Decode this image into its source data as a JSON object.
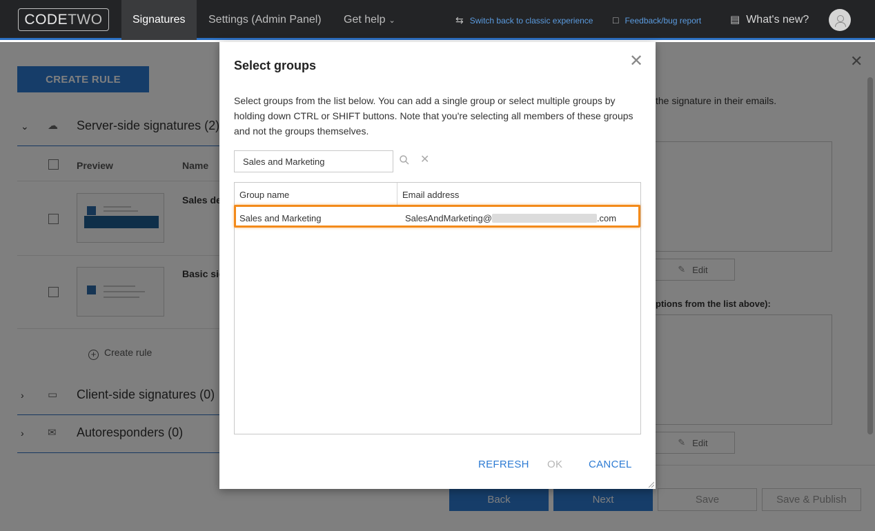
{
  "topbar": {
    "logo_code": "CODE",
    "logo_two": "TWO",
    "tabs": [
      {
        "label": "Signatures"
      },
      {
        "label": "Settings (Admin Panel)"
      },
      {
        "label": "Get help"
      }
    ],
    "switch_link": "Switch back to classic experience",
    "feedback_link": "Feedback/bug report",
    "whats_new": "What's new?"
  },
  "left": {
    "create_rule_button": "CREATE RULE",
    "sections": [
      {
        "title": "Server-side signatures (2)"
      },
      {
        "title": "Client-side signatures (0)"
      },
      {
        "title": "Autoresponders (0)"
      }
    ],
    "columns": {
      "preview": "Preview",
      "name": "Name"
    },
    "rules": [
      {
        "name": "Sales de"
      },
      {
        "name": "Basic sig"
      }
    ],
    "create_rule_link": "Create rule"
  },
  "right": {
    "text_top": "the signature in their emails.",
    "text_exceptions": "ptions from the list above):",
    "edit_label": "Edit",
    "footer": {
      "back": "Back",
      "next": "Next",
      "save": "Save",
      "save_publish": "Save & Publish"
    }
  },
  "modal": {
    "title": "Select groups",
    "description": "Select groups from the list below. You can add a single group or select multiple groups by holding down CTRL or SHIFT buttons. Note that you're selecting all members of these groups and not the groups themselves.",
    "search_value": "Sales and Marketing",
    "columns": {
      "group_name": "Group name",
      "email": "Email address"
    },
    "rows": [
      {
        "group_name": "Sales and Marketing",
        "email_prefix": "SalesAndMarketing@",
        "email_suffix": ".com"
      }
    ],
    "buttons": {
      "refresh": "REFRESH",
      "ok": "OK",
      "cancel": "CANCEL"
    }
  },
  "colors": {
    "accent": "#2d7bd3",
    "highlight": "#f38a1a",
    "topbar": "#232426"
  }
}
